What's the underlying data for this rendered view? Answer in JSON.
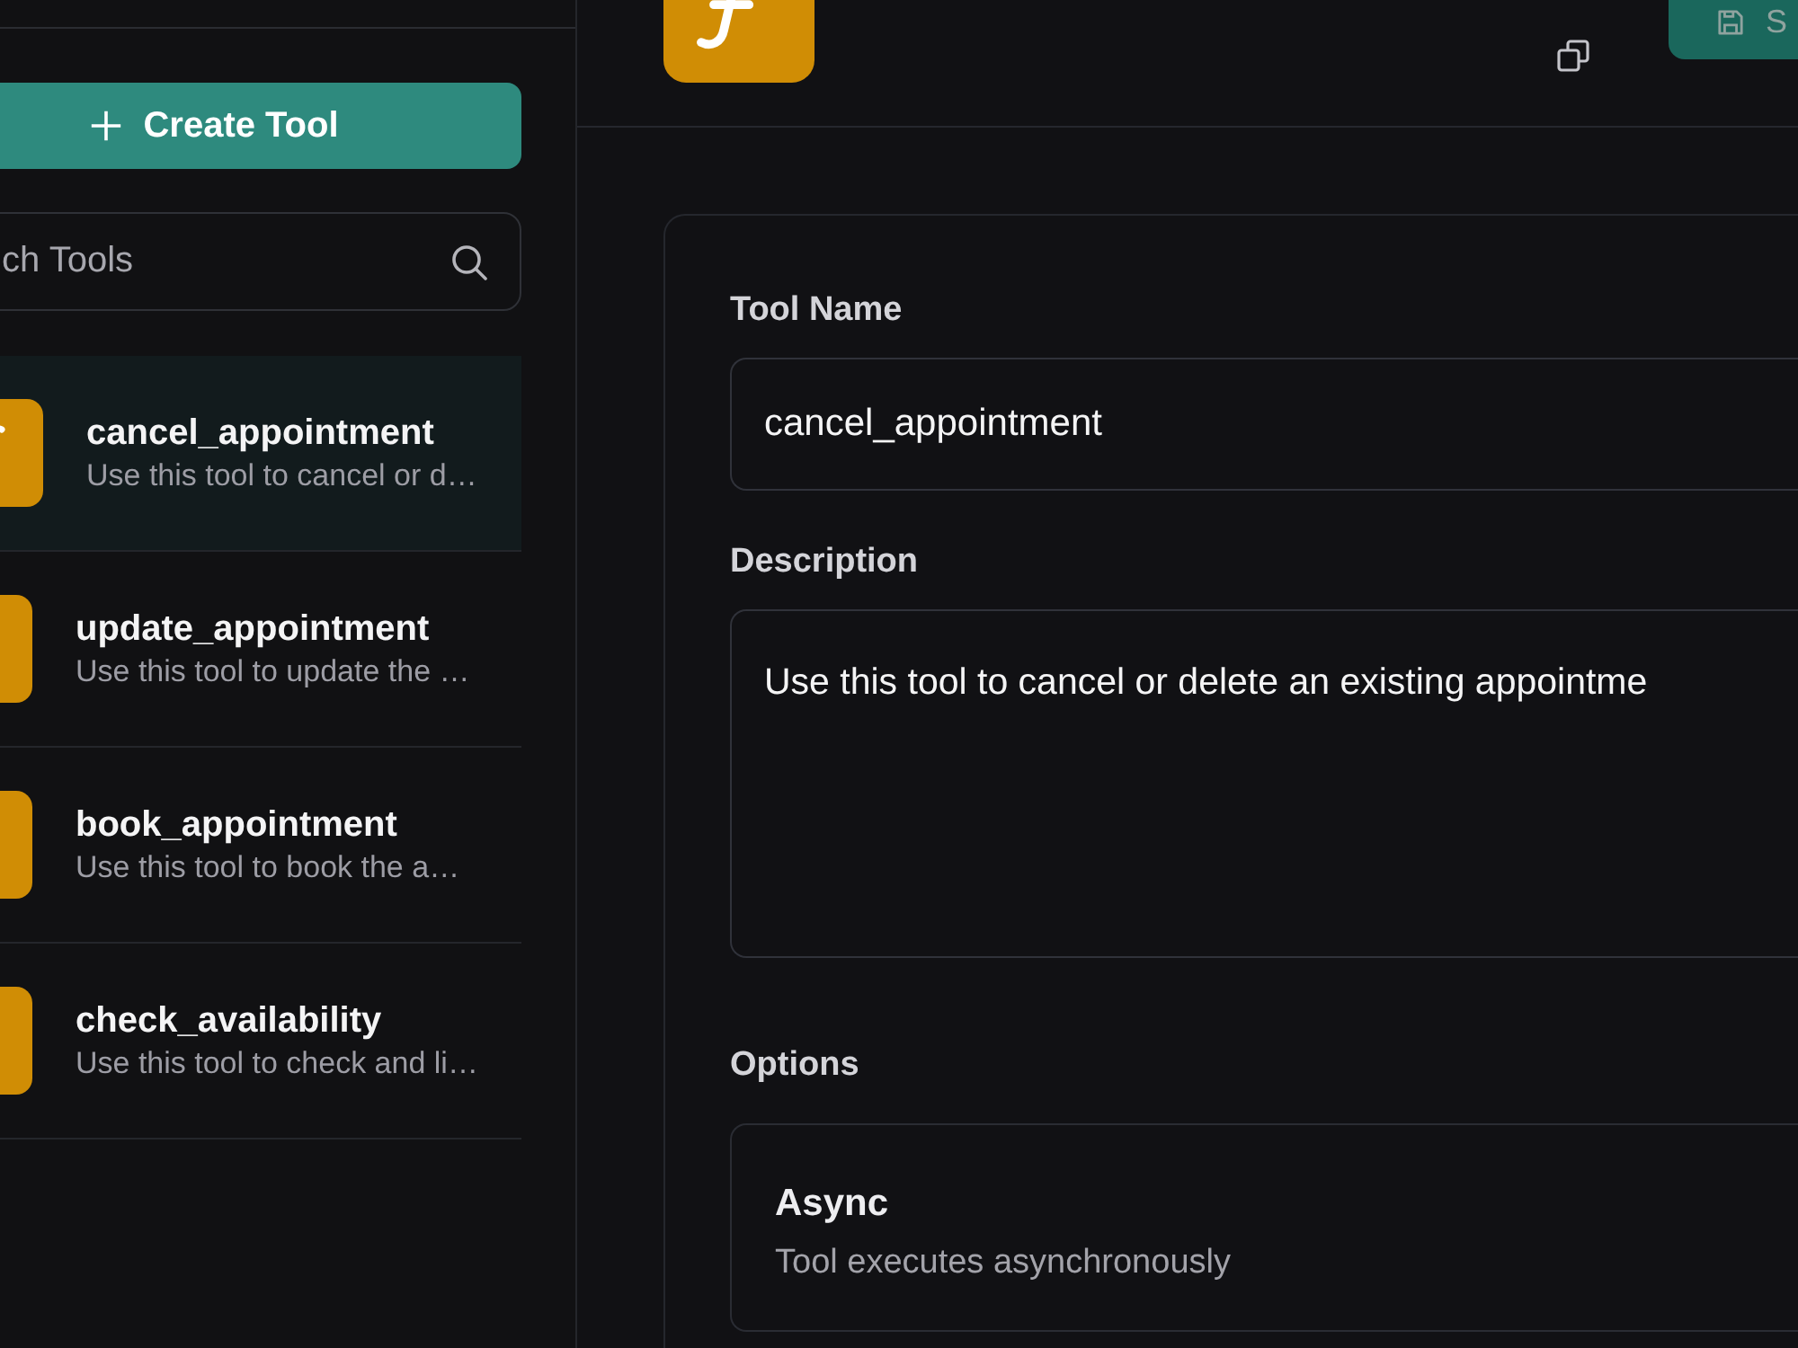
{
  "sidebar": {
    "create_button": {
      "label": "Create Tool"
    },
    "search": {
      "placeholder": "ch Tools"
    },
    "tools": [
      {
        "name": "cancel_appointment",
        "description": "Use this tool to cancel or d…",
        "selected": true
      },
      {
        "name": "update_appointment",
        "description": "Use this tool to update the …",
        "selected": false
      },
      {
        "name": "book_appointment",
        "description": "Use this tool to book the a…",
        "selected": false
      },
      {
        "name": "check_availability",
        "description": "Use this tool to check and li…",
        "selected": false
      }
    ]
  },
  "header": {
    "save_button": {
      "label": "S",
      "disabled": true
    }
  },
  "form": {
    "fields": [
      {
        "kind": "input",
        "label": "Tool Name",
        "value": "cancel_appointment"
      },
      {
        "kind": "textarea",
        "label": "Description",
        "value": "Use this tool to cancel or delete an existing appointme"
      }
    ],
    "options": {
      "label": "Options",
      "items": [
        {
          "title": "Async",
          "description": "Tool executes asynchronously"
        }
      ]
    }
  }
}
